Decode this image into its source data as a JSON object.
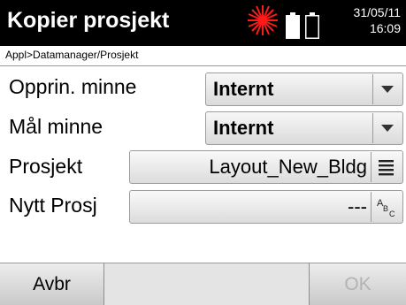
{
  "titlebar": {
    "title": "Kopier prosjekt",
    "date": "31/05/11",
    "time": "16:09",
    "icons": [
      "laser-icon",
      "battery-icon",
      "battery-icon"
    ],
    "laser_color": "#ff0000"
  },
  "breadcrumb": "Appl>Datamanager/Prosjekt",
  "form": {
    "source_memory": {
      "label": "Opprin. minne",
      "value": "Internt"
    },
    "target_memory": {
      "label": "Mål minne",
      "value": "Internt"
    },
    "project": {
      "label": "Prosjekt",
      "value": "Layout_New_Bldg",
      "icon": "list-icon"
    },
    "new_project": {
      "label": "Nytt Prosj",
      "value": "---",
      "icon": "abc-input-icon"
    }
  },
  "softkeys": {
    "left": "Avbr",
    "right": "OK"
  }
}
